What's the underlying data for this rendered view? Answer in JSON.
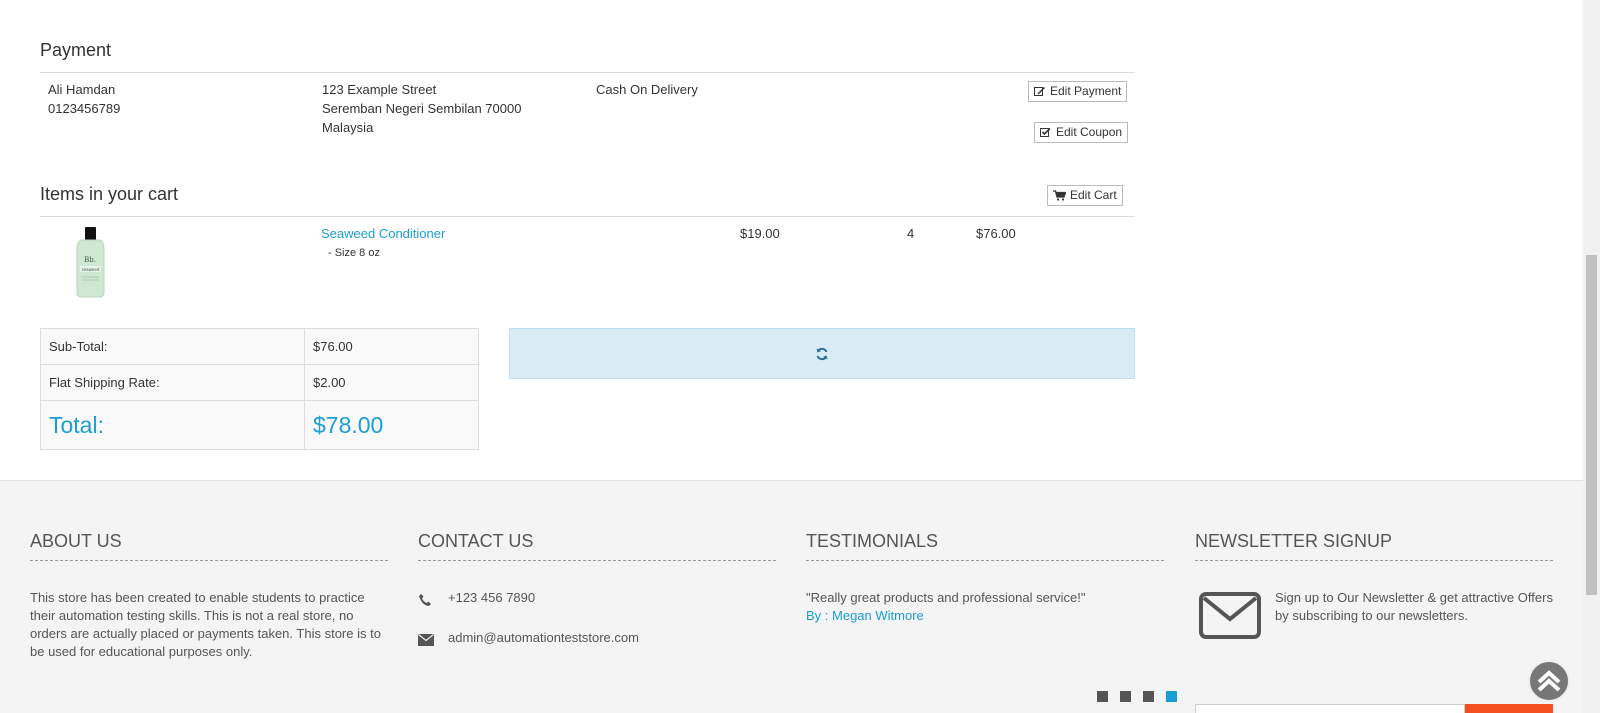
{
  "payment": {
    "title": "Payment",
    "name": "Ali Hamdan",
    "phone": "0123456789",
    "address_line1": "123 Example Street",
    "address_line2": "Seremban Negeri Sembilan 70000",
    "address_line3": "Malaysia",
    "method": "Cash On Delivery",
    "edit_payment_label": "Edit Payment",
    "edit_coupon_label": "Edit Coupon"
  },
  "cart": {
    "title": "Items in your cart",
    "edit_cart_label": "Edit Cart",
    "items": [
      {
        "name": "Seaweed Conditioner",
        "option": "- Size 8 oz",
        "price": "$19.00",
        "quantity": "4",
        "total": "$76.00",
        "thumbnail_label": "Bb. seaweed"
      }
    ]
  },
  "totals": {
    "subtotal_label": "Sub-Total:",
    "subtotal_value": "$76.00",
    "shipping_label": "Flat Shipping Rate:",
    "shipping_value": "$2.00",
    "total_label": "Total:",
    "total_value": "$78.00"
  },
  "footer": {
    "about": {
      "title": "ABOUT US",
      "text": "This store has been created to enable students to practice their automation testing skills. This is not a real store, no orders are actually placed or payments taken. This store is to be used for educational purposes only."
    },
    "contact": {
      "title": "CONTACT US",
      "phone": "+123 456 7890",
      "email": "admin@automationteststore.com"
    },
    "testimonials": {
      "title": "TESTIMONIALS",
      "quote": "\"Really great products and professional service!\"",
      "author": "By : Megan Witmore",
      "slides": 4,
      "active_slide": 4
    },
    "newsletter": {
      "title": "NEWSLETTER SIGNUP",
      "text": "Sign up to Our Newsletter & get attractive Offers by subscribing to our newsletters."
    }
  },
  "colors": {
    "accent": "#1a9ed6",
    "info_box": "#d9ecf5",
    "footer_bg": "#f4f4f4",
    "newsletter_button": "#f4511e"
  }
}
